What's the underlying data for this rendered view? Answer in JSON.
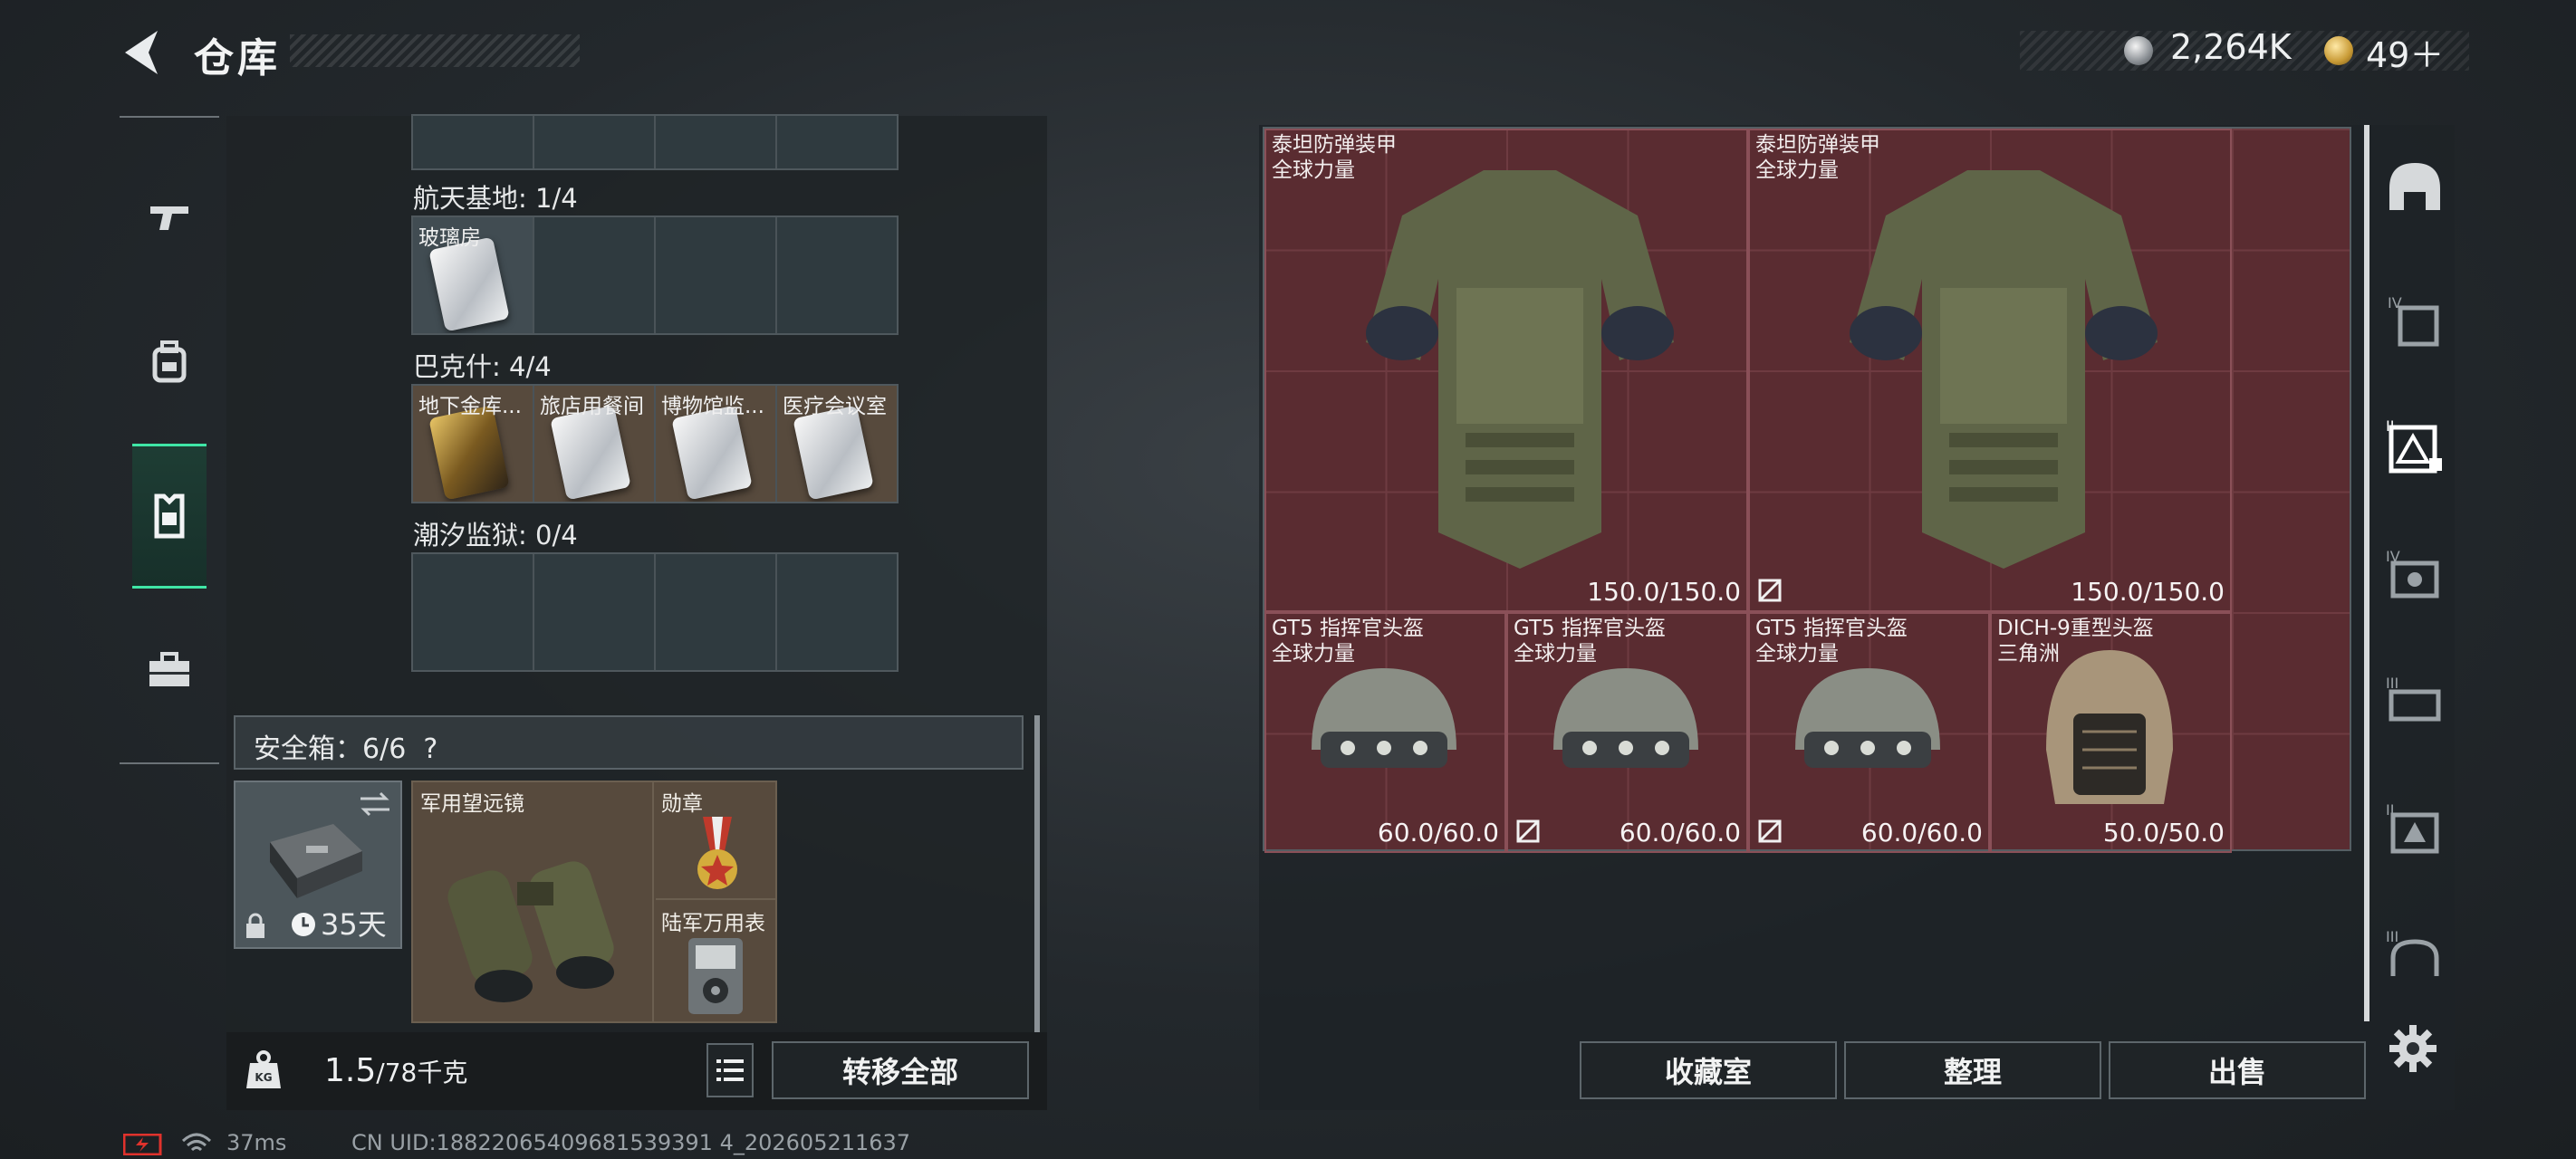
{
  "header": {
    "title": "仓库",
    "silver_amount": "2,264K",
    "gold_amount": "49＋"
  },
  "nav": {
    "items": [
      {
        "name": "weapon"
      },
      {
        "name": "backpack"
      },
      {
        "name": "armor-vest"
      },
      {
        "name": "toolbox"
      }
    ],
    "active": "armor-vest"
  },
  "keycards": {
    "top_row": [
      "",
      "",
      "",
      ""
    ],
    "groups": [
      {
        "label": "航天基地: 1/4",
        "cells": [
          "玻璃房",
          "",
          "",
          ""
        ]
      },
      {
        "label": "巴克什: 4/4",
        "cells": [
          "地下金库...",
          "旅店用餐间",
          "博物馆监...",
          "医疗会议室"
        ]
      },
      {
        "label": "潮汐监狱: 0/4",
        "cells": [
          "",
          "",
          "",
          ""
        ]
      }
    ]
  },
  "safe": {
    "label": "安全箱：6/6",
    "help": "?",
    "bag_timer": "35天",
    "items": [
      {
        "label": "军用望远镜"
      },
      {
        "label": "勋章"
      },
      {
        "label": "陆军万用表"
      }
    ]
  },
  "weight": {
    "current": "1.5",
    "max": "/78千克"
  },
  "actions": {
    "transfer_all": "转移全部"
  },
  "stash": {
    "armors": [
      {
        "name": "泰坦防弹装甲",
        "sub": "全球力量",
        "durability": "150.0/150.0"
      },
      {
        "name": "泰坦防弹装甲",
        "sub": "全球力量",
        "durability": "150.0/150.0"
      }
    ],
    "helmets": [
      {
        "name": "GT5 指挥官头盔",
        "sub": "全球力量",
        "durability": "60.0/60.0"
      },
      {
        "name": "GT5 指挥官头盔",
        "sub": "全球力量",
        "durability": "60.0/60.0"
      },
      {
        "name": "GT5 指挥官头盔",
        "sub": "全球力量",
        "durability": "60.0/60.0"
      },
      {
        "name": "DICH-9重型头盔",
        "sub": "三角洲",
        "durability": "50.0/50.0"
      }
    ]
  },
  "buttons": {
    "collection": "收藏室",
    "organize": "整理",
    "sell": "出售"
  },
  "status": {
    "ping": "37ms",
    "uid": "CN UID:18822065409681539391 4_202605211637"
  }
}
